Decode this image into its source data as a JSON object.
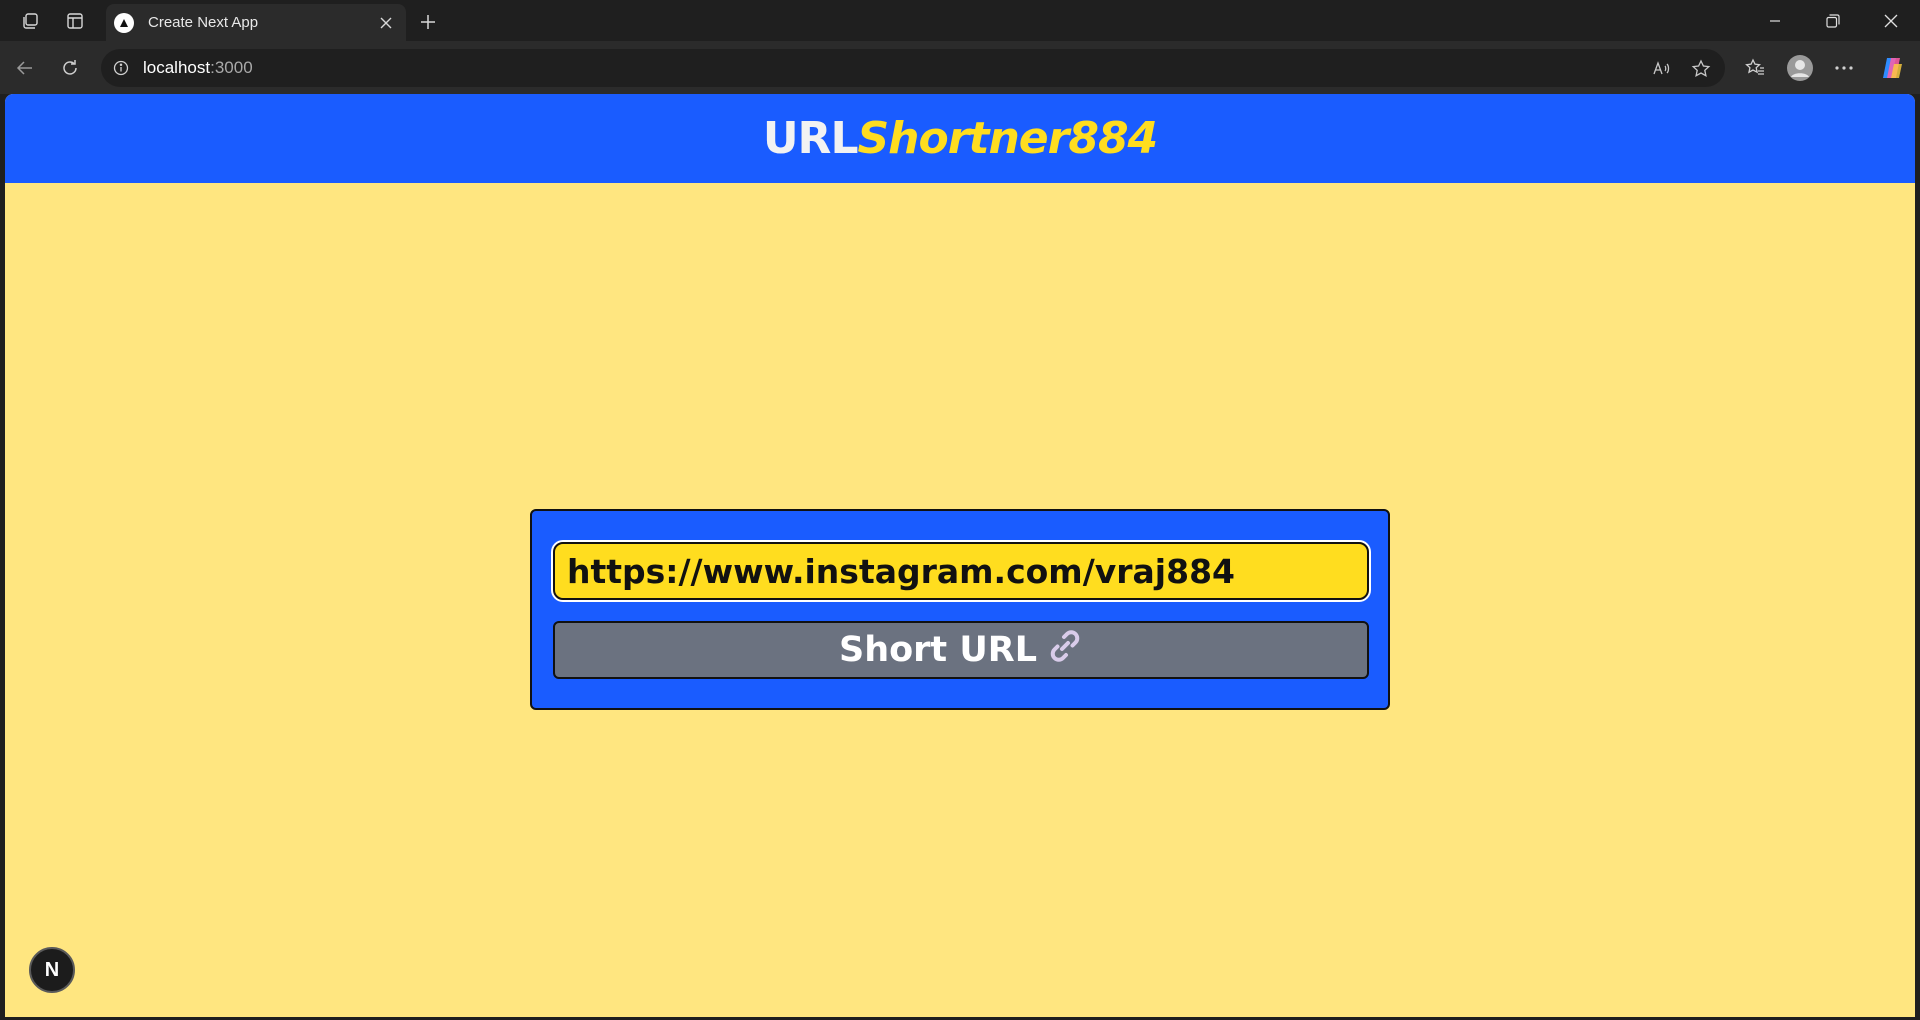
{
  "browser": {
    "tab_title": "Create Next App",
    "address_host": "localhost",
    "address_port": ":3000"
  },
  "header": {
    "brand_main": "URL",
    "brand_accent": "Shortner884"
  },
  "form": {
    "url_value": "https://www.instagram.com/vraj884",
    "submit_label": "Short URL",
    "submit_icon": "link-icon"
  },
  "dev_badge": {
    "label": "N"
  },
  "colors": {
    "header_bg": "#1a5cff",
    "page_bg": "#ffe680",
    "accent_yellow": "#ffdd1f",
    "button_gray": "#6b7280"
  }
}
